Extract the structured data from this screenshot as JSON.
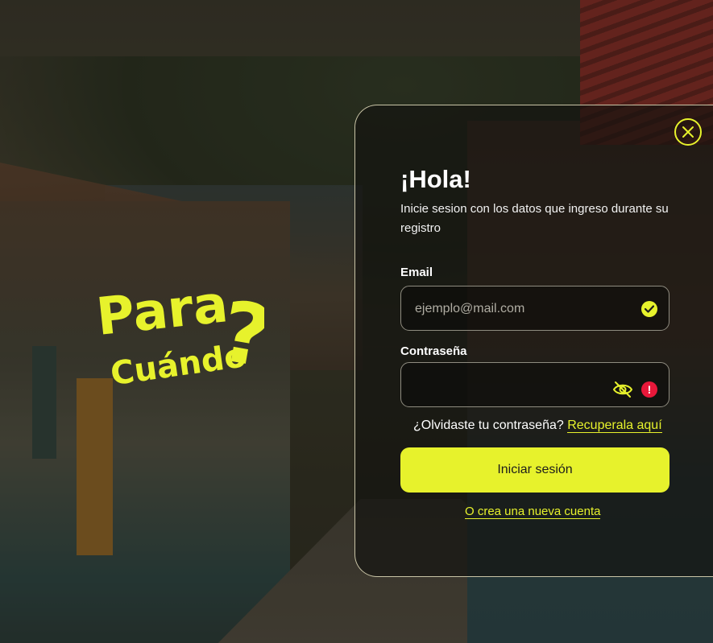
{
  "logo": {
    "line1": "Para",
    "line2": "Cuándo",
    "mark": "?"
  },
  "close": {
    "icon": "close-icon"
  },
  "login": {
    "title": "¡Hola!",
    "subtitle": "Inicie sesion con los datos que ingreso durante su registro",
    "email_label": "Email",
    "email_placeholder": "ejemplo@mail.com",
    "password_label": "Contraseña",
    "password_value": "",
    "forgot_text": "¿Olvidaste tu contraseña?",
    "forgot_link": "Recuperala aquí",
    "submit_label": "Iniciar sesión",
    "create_link": "O crea una nueva cuenta"
  },
  "colors": {
    "accent": "#e7f22c",
    "error": "#e8183a",
    "card_border": "#c9c4a6"
  },
  "icons": {
    "email_status": "check-circle-icon",
    "password_toggle": "eye-off-icon",
    "password_status": "error-icon"
  }
}
